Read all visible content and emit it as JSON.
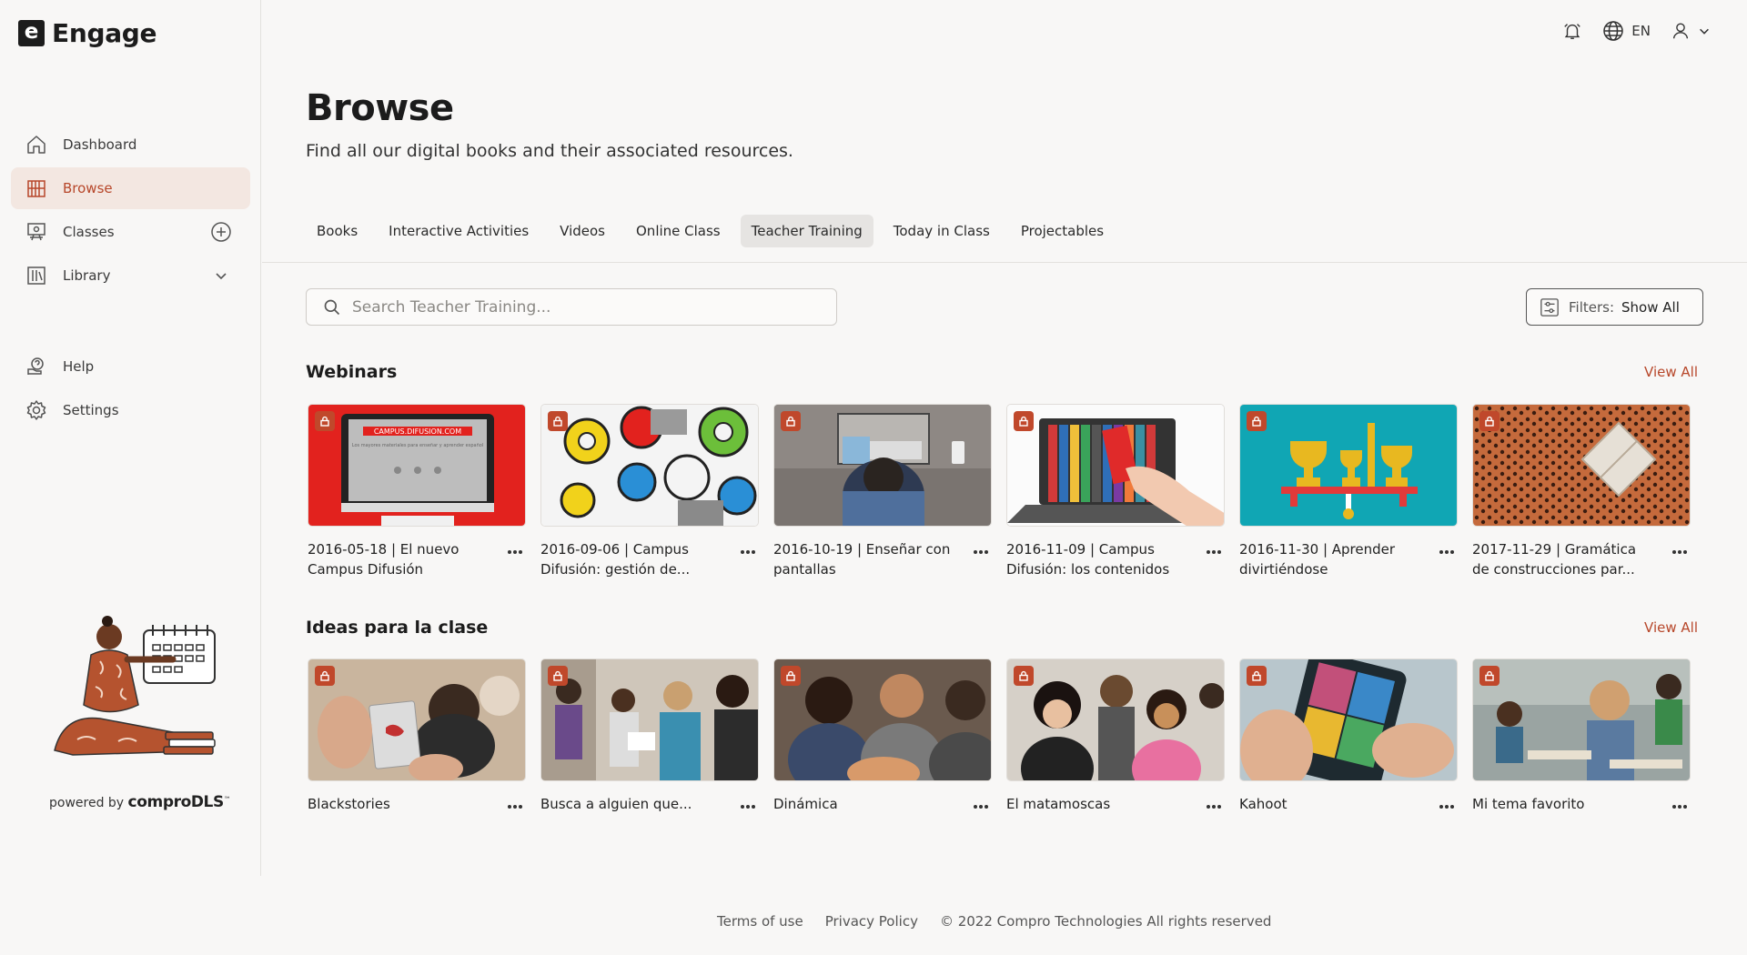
{
  "app": {
    "logo_mark": "e",
    "name": "Engage"
  },
  "sidebar": {
    "items": [
      {
        "label": "Dashboard",
        "icon": "home-icon"
      },
      {
        "label": "Browse",
        "icon": "browse-icon",
        "active": true
      },
      {
        "label": "Classes",
        "icon": "classes-icon",
        "action_icon": "plus-circle-icon"
      },
      {
        "label": "Library",
        "icon": "library-icon",
        "action_icon": "chevron-down-icon"
      },
      {
        "label": "Help",
        "icon": "help-icon"
      },
      {
        "label": "Settings",
        "icon": "gear-icon"
      }
    ],
    "powered_prefix": "powered by",
    "powered_brand": "comproDLS",
    "powered_tm": "™"
  },
  "topbar": {
    "language": "EN"
  },
  "page": {
    "title": "Browse",
    "subtitle": "Find all our digital books and their associated resources."
  },
  "tabs": [
    {
      "label": "Books"
    },
    {
      "label": "Interactive Activities"
    },
    {
      "label": "Videos"
    },
    {
      "label": "Online Class"
    },
    {
      "label": "Teacher Training",
      "active": true
    },
    {
      "label": "Today in Class"
    },
    {
      "label": "Projectables"
    }
  ],
  "search": {
    "placeholder": "Search Teacher Training..."
  },
  "filters": {
    "label": "Filters:",
    "value": "Show All"
  },
  "sections": [
    {
      "title": "Webinars",
      "view_all": "View All",
      "cards": [
        {
          "title": "2016-05-18 | El nuevo Campus Difusión",
          "thumb_caption": "CAMPUS.DIFUSION.COM",
          "thumb_text": "Los mayores materiales para enseñar y aprender español"
        },
        {
          "title": "2016-09-06 | Campus Difusión: gestión de..."
        },
        {
          "title": "2016-10-19 | Enseñar con pantallas"
        },
        {
          "title": "2016-11-09 | Campus Difusión: los contenidos"
        },
        {
          "title": "2016-11-30 | Aprender divirtiéndose"
        },
        {
          "title": "2017-11-29 | Gramática de construcciones par..."
        }
      ]
    },
    {
      "title": "Ideas para la clase",
      "view_all": "View All",
      "cards": [
        {
          "title": "Blackstories"
        },
        {
          "title": "Busca a alguien que..."
        },
        {
          "title": "Dinámica"
        },
        {
          "title": "El matamoscas"
        },
        {
          "title": "Kahoot"
        },
        {
          "title": "Mi tema favorito"
        }
      ]
    }
  ],
  "footer": {
    "terms": "Terms of use",
    "privacy": "Privacy Policy",
    "copyright": "© 2022 Compro Technologies All rights reserved"
  },
  "colors": {
    "accent": "#b7472a",
    "active_bg": "#f3e7e1",
    "background": "#f8f7f6"
  }
}
